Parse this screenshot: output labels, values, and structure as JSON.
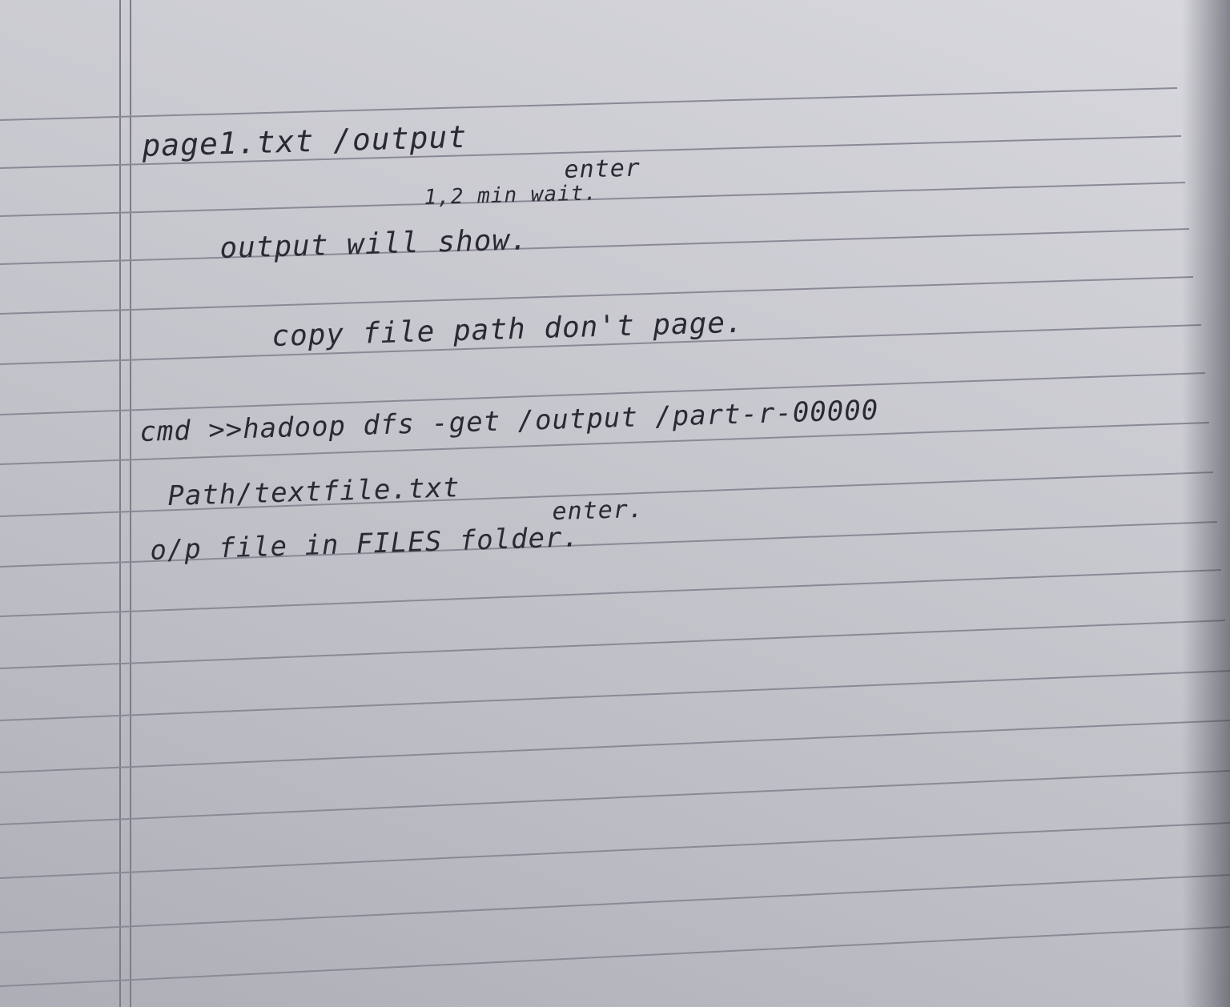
{
  "notes": {
    "line1": "page1.txt /output",
    "line1_note": "enter",
    "line2": "1,2 min wait.",
    "line3": "output will show.",
    "line4": "copy file path don't page.",
    "line5": "cmd >>hadoop dfs -get /output /part-r-00000",
    "line6": "Path/textfile.txt",
    "line6_note": "enter.",
    "line7": "o/p file in FILES folder."
  }
}
